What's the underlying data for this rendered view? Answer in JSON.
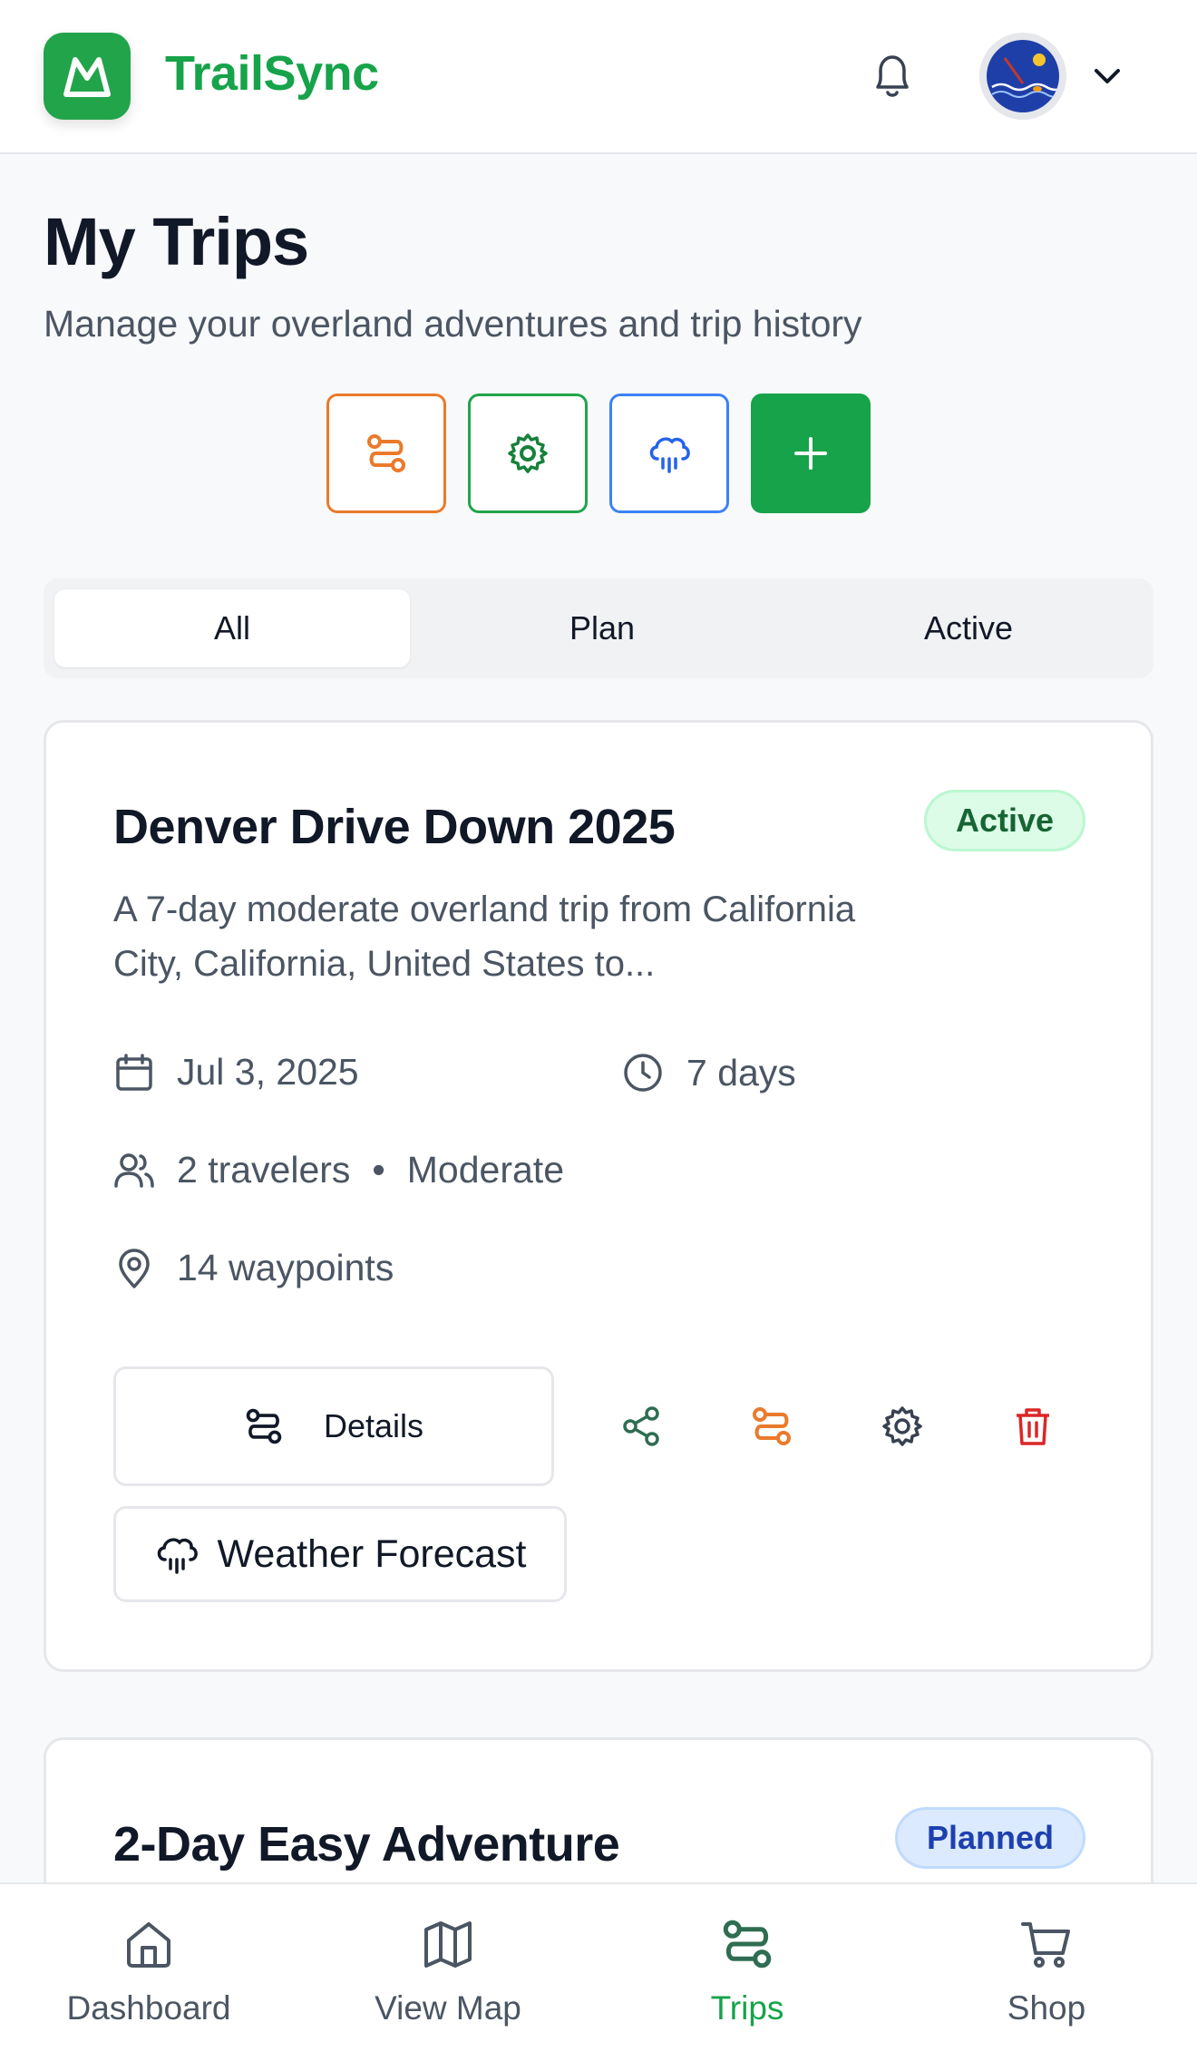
{
  "header": {
    "app_name": "TrailSync",
    "brand_color": "#16a34a",
    "icons": [
      "mountain-logo-icon",
      "bell-icon",
      "avatar",
      "chevron-down-icon"
    ]
  },
  "page": {
    "title": "My Trips",
    "subtitle": "Manage your overland adventures and trip history"
  },
  "actions": {
    "icons": [
      "route-icon",
      "gear-icon",
      "cloud-rain-icon",
      "plus-icon"
    ]
  },
  "tabs": [
    {
      "label": "All",
      "selected": true
    },
    {
      "label": "Plan",
      "selected": false
    },
    {
      "label": "Active",
      "selected": false
    }
  ],
  "trips": [
    {
      "title": "Denver Drive Down 2025",
      "status": "Active",
      "status_color": "#166534",
      "description": "A 7-day moderate overland trip from California City, California, United States to...",
      "date": "Jul 3, 2025",
      "duration": "7 days",
      "travelers": "2 travelers",
      "difficulty": "Moderate",
      "separator": "•",
      "waypoints": "14 waypoints",
      "details_label": "Details",
      "weather_label": "Weather Forecast",
      "icon_actions": [
        "share-icon",
        "route-icon",
        "gear-icon",
        "trash-icon"
      ]
    },
    {
      "title": "2-Day Easy Adventure",
      "status": "Planned",
      "status_color": "#1e40af"
    }
  ],
  "bottom_nav": [
    {
      "label": "Dashboard",
      "icon": "home-icon",
      "active": false
    },
    {
      "label": "View Map",
      "icon": "map-icon",
      "active": false
    },
    {
      "label": "Trips",
      "icon": "route-icon",
      "active": true
    },
    {
      "label": "Shop",
      "icon": "cart-icon",
      "active": false
    }
  ]
}
